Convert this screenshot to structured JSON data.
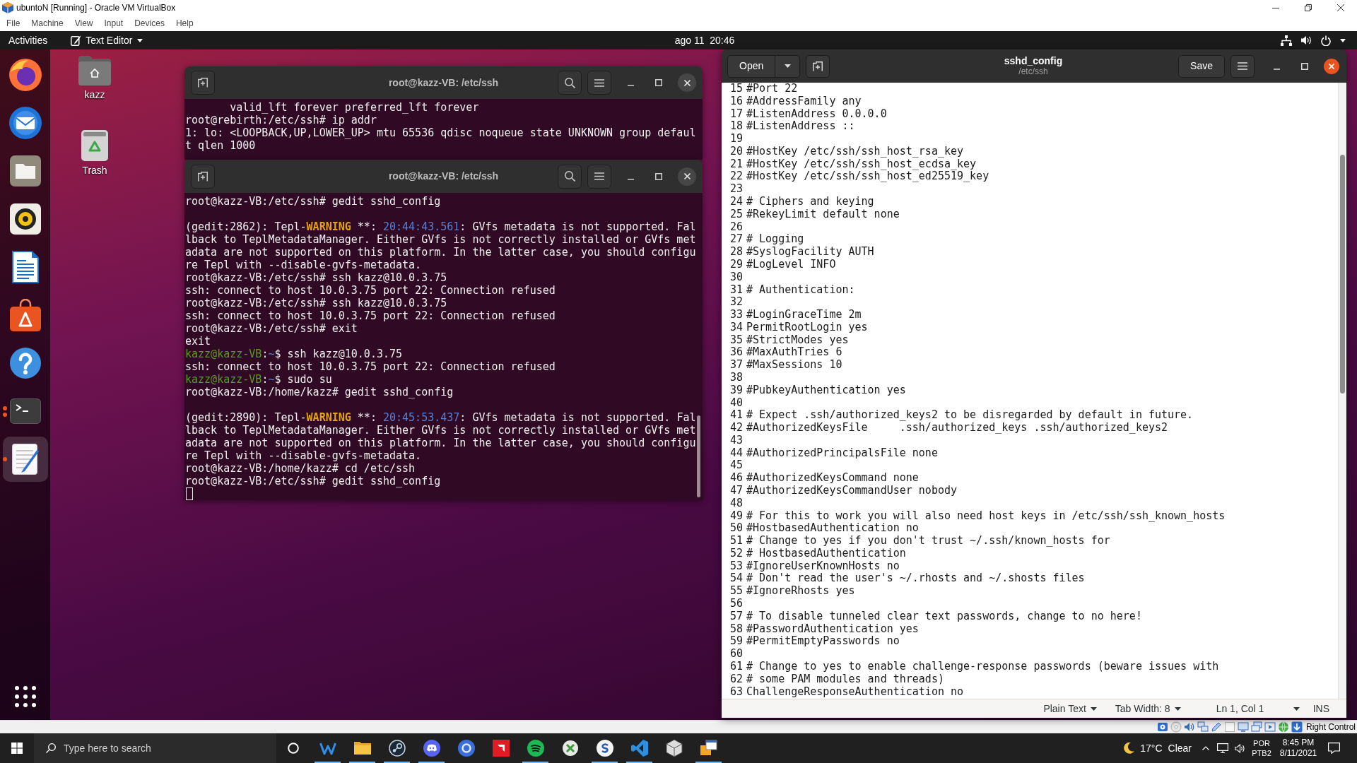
{
  "vbox": {
    "title": "ubuntoN [Running] - Oracle VM VirtualBox",
    "menu": [
      "File",
      "Machine",
      "View",
      "Input",
      "Devices",
      "Help"
    ],
    "host_key": "Right Control"
  },
  "top_bar": {
    "activities": "Activities",
    "app_menu": "Text Editor",
    "clock": "ago 11  20:46"
  },
  "dock": [
    {
      "kind": "browser",
      "selected": false,
      "running": false
    },
    {
      "kind": "mail",
      "selected": false,
      "running": false
    },
    {
      "kind": "files",
      "selected": false,
      "running": false
    },
    {
      "kind": "music",
      "selected": false,
      "running": false
    },
    {
      "kind": "writer",
      "selected": false,
      "running": false
    },
    {
      "kind": "store",
      "selected": false,
      "running": false
    },
    {
      "kind": "help",
      "selected": false,
      "running": false
    },
    {
      "kind": "terminal",
      "selected": false,
      "running": true,
      "multiple_windows": true
    },
    {
      "kind": "editor",
      "selected": true,
      "running": true,
      "multiple_windows": false
    }
  ],
  "desktop_icons": [
    {
      "kind": "home",
      "label": "kazz"
    },
    {
      "kind": "trash",
      "label": "Trash"
    }
  ],
  "terminals": [
    {
      "title": "root@kazz-VB: /etc/ssh",
      "cursor": false,
      "lines": [
        {
          "kind": "text",
          "text": "       valid_lft forever preferred_lft forever"
        },
        {
          "kind": "text",
          "text": "root@rebirth:/etc/ssh# ip addr"
        },
        {
          "kind": "text",
          "text": "1: lo: <LOOPBACK,UP,LOWER_UP> mtu 65536 qdisc noqueue state UNKNOWN group defaul"
        },
        {
          "kind": "text",
          "text": "t qlen 1000"
        }
      ]
    },
    {
      "title": "root@kazz-VB: /etc/ssh",
      "cursor": true,
      "lines": [
        {
          "kind": "text",
          "text": "root@kazz-VB:/etc/ssh# gedit sshd_config"
        },
        {
          "kind": "blank"
        },
        {
          "kind": "styled",
          "segments": [
            {
              "kind": "plain",
              "text": "(gedit:2862): Tepl-"
            },
            {
              "kind": "warning",
              "text": "WARNING"
            },
            {
              "kind": "plain",
              "text": " **: "
            },
            {
              "kind": "time",
              "text": "20:44:43.561"
            },
            {
              "kind": "plain",
              "text": ": GVfs metadata is not supported. Fal"
            }
          ]
        },
        {
          "kind": "text",
          "text": "lback to TeplMetadataManager. Either GVfs is not correctly installed or GVfs met"
        },
        {
          "kind": "text",
          "text": "adata are not supported on this platform. In the latter case, you should configu"
        },
        {
          "kind": "text",
          "text": "re Tepl with --disable-gvfs-metadata."
        },
        {
          "kind": "text",
          "text": "root@kazz-VB:/etc/ssh# ssh kazz@10.0.3.75"
        },
        {
          "kind": "text",
          "text": "ssh: connect to host 10.0.3.75 port 22: Connection refused"
        },
        {
          "kind": "text",
          "text": "root@kazz-VB:/etc/ssh# ssh kazz@10.0.3.75"
        },
        {
          "kind": "text",
          "text": "ssh: connect to host 10.0.3.75 port 22: Connection refused"
        },
        {
          "kind": "text",
          "text": "root@kazz-VB:/etc/ssh# exit"
        },
        {
          "kind": "text",
          "text": "exit"
        },
        {
          "kind": "styled",
          "segments": [
            {
              "kind": "user",
              "text": "kazz@kazz-VB"
            },
            {
              "kind": "plain",
              "text": ":"
            },
            {
              "kind": "path",
              "text": "~"
            },
            {
              "kind": "plain",
              "text": "$ ssh kazz@10.0.3.75"
            }
          ]
        },
        {
          "kind": "text",
          "text": "ssh: connect to host 10.0.3.75 port 22: Connection refused"
        },
        {
          "kind": "styled",
          "segments": [
            {
              "kind": "user",
              "text": "kazz@kazz-VB"
            },
            {
              "kind": "plain",
              "text": ":"
            },
            {
              "kind": "path",
              "text": "~"
            },
            {
              "kind": "plain",
              "text": "$ sudo su"
            }
          ]
        },
        {
          "kind": "text",
          "text": "root@kazz-VB:/home/kazz# gedit sshd_config"
        },
        {
          "kind": "blank"
        },
        {
          "kind": "styled",
          "segments": [
            {
              "kind": "plain",
              "text": "(gedit:2890): Tepl-"
            },
            {
              "kind": "warning",
              "text": "WARNING"
            },
            {
              "kind": "plain",
              "text": " **: "
            },
            {
              "kind": "time",
              "text": "20:45:53.437"
            },
            {
              "kind": "plain",
              "text": ": GVfs metadata is not supported. Fal"
            }
          ]
        },
        {
          "kind": "text",
          "text": "lback to TeplMetadataManager. Either GVfs is not correctly installed or GVfs met"
        },
        {
          "kind": "text",
          "text": "adata are not supported on this platform. In the latter case, you should configu"
        },
        {
          "kind": "text",
          "text": "re Tepl with --disable-gvfs-metadata."
        },
        {
          "kind": "text",
          "text": "root@kazz-VB:/home/kazz# cd /etc/ssh"
        },
        {
          "kind": "text",
          "text": "root@kazz-VB:/etc/ssh# gedit sshd_config"
        }
      ]
    }
  ],
  "editor": {
    "open": "Open",
    "title": "sshd_config",
    "subtitle": "/etc/ssh",
    "save": "Save",
    "lines": [
      {
        "number": "15",
        "text": "#Port 22"
      },
      {
        "number": "16",
        "text": "#AddressFamily any"
      },
      {
        "number": "17",
        "text": "#ListenAddress 0.0.0.0"
      },
      {
        "number": "18",
        "text": "#ListenAddress ::"
      },
      {
        "number": "19"
      },
      {
        "number": "20",
        "text": "#HostKey /etc/ssh/ssh_host_rsa_key"
      },
      {
        "number": "21",
        "text": "#HostKey /etc/ssh/ssh_host_ecdsa_key"
      },
      {
        "number": "22",
        "text": "#HostKey /etc/ssh/ssh_host_ed25519_key"
      },
      {
        "number": "23"
      },
      {
        "number": "24",
        "text": "# Ciphers and keying"
      },
      {
        "number": "25",
        "text": "#RekeyLimit default none"
      },
      {
        "number": "26"
      },
      {
        "number": "27",
        "text": "# Logging"
      },
      {
        "number": "28",
        "text": "#SyslogFacility AUTH"
      },
      {
        "number": "29",
        "text": "#LogLevel INFO"
      },
      {
        "number": "30"
      },
      {
        "number": "31",
        "text": "# Authentication:"
      },
      {
        "number": "32"
      },
      {
        "number": "33",
        "text": "#LoginGraceTime 2m"
      },
      {
        "number": "34",
        "text": "PermitRootLogin yes"
      },
      {
        "number": "35",
        "text": "#StrictModes yes"
      },
      {
        "number": "36",
        "text": "#MaxAuthTries 6"
      },
      {
        "number": "37",
        "text": "#MaxSessions 10"
      },
      {
        "number": "38"
      },
      {
        "number": "39",
        "text": "#PubkeyAuthentication yes"
      },
      {
        "number": "40"
      },
      {
        "number": "41",
        "text": "# Expect .ssh/authorized_keys2 to be disregarded by default in future."
      },
      {
        "number": "42",
        "text": "#AuthorizedKeysFile     .ssh/authorized_keys .ssh/authorized_keys2"
      },
      {
        "number": "43"
      },
      {
        "number": "44",
        "text": "#AuthorizedPrincipalsFile none"
      },
      {
        "number": "45"
      },
      {
        "number": "46",
        "text": "#AuthorizedKeysCommand none"
      },
      {
        "number": "47",
        "text": "#AuthorizedKeysCommandUser nobody"
      },
      {
        "number": "48"
      },
      {
        "number": "49",
        "text": "# For this to work you will also need host keys in /etc/ssh/ssh_known_hosts"
      },
      {
        "number": "50",
        "text": "#HostbasedAuthentication no"
      },
      {
        "number": "51",
        "text": "# Change to yes if you don't trust ~/.ssh/known_hosts for"
      },
      {
        "number": "52",
        "text": "# HostbasedAuthentication"
      },
      {
        "number": "53",
        "text": "#IgnoreUserKnownHosts no"
      },
      {
        "number": "54",
        "text": "# Don't read the user's ~/.rhosts and ~/.shosts files"
      },
      {
        "number": "55",
        "text": "#IgnoreRhosts yes"
      },
      {
        "number": "56"
      },
      {
        "number": "57",
        "text": "# To disable tunneled clear text passwords, change to no here!"
      },
      {
        "number": "58",
        "text": "#PasswordAuthentication yes"
      },
      {
        "number": "59",
        "text": "#PermitEmptyPasswords no"
      },
      {
        "number": "60"
      },
      {
        "number": "61",
        "text": "# Change to yes to enable challenge-response passwords (beware issues with"
      },
      {
        "number": "62",
        "text": "# some PAM modules and threads)"
      },
      {
        "number": "63",
        "text": "ChallengeResponseAuthentication no"
      }
    ],
    "status": {
      "language": "Plain Text",
      "tab_width": "Tab Width: 8",
      "position": "Ln 1, Col 1",
      "mode": "INS"
    }
  },
  "taskbar": {
    "search": {
      "placeholder": "Type here to search"
    },
    "apps": [
      {
        "kind": "zigzag",
        "running": true
      },
      {
        "kind": "folder",
        "running": true
      },
      {
        "kind": "knob",
        "running": true
      },
      {
        "kind": "controller",
        "running": true
      },
      {
        "kind": "ring",
        "running": false
      },
      {
        "kind": "square",
        "running": false
      },
      {
        "kind": "waves",
        "running": true
      },
      {
        "kind": "x_ball",
        "running": false
      },
      {
        "kind": "swirl",
        "running": true
      },
      {
        "kind": "ribbon",
        "running": true
      },
      {
        "kind": "cube",
        "running": false
      },
      {
        "kind": "window_stack",
        "running": true
      }
    ],
    "temperature": "17°C",
    "condition": "Clear",
    "language": "POR",
    "layout": "PTB2",
    "time": "8:45 PM",
    "date": "8/11/2021"
  }
}
